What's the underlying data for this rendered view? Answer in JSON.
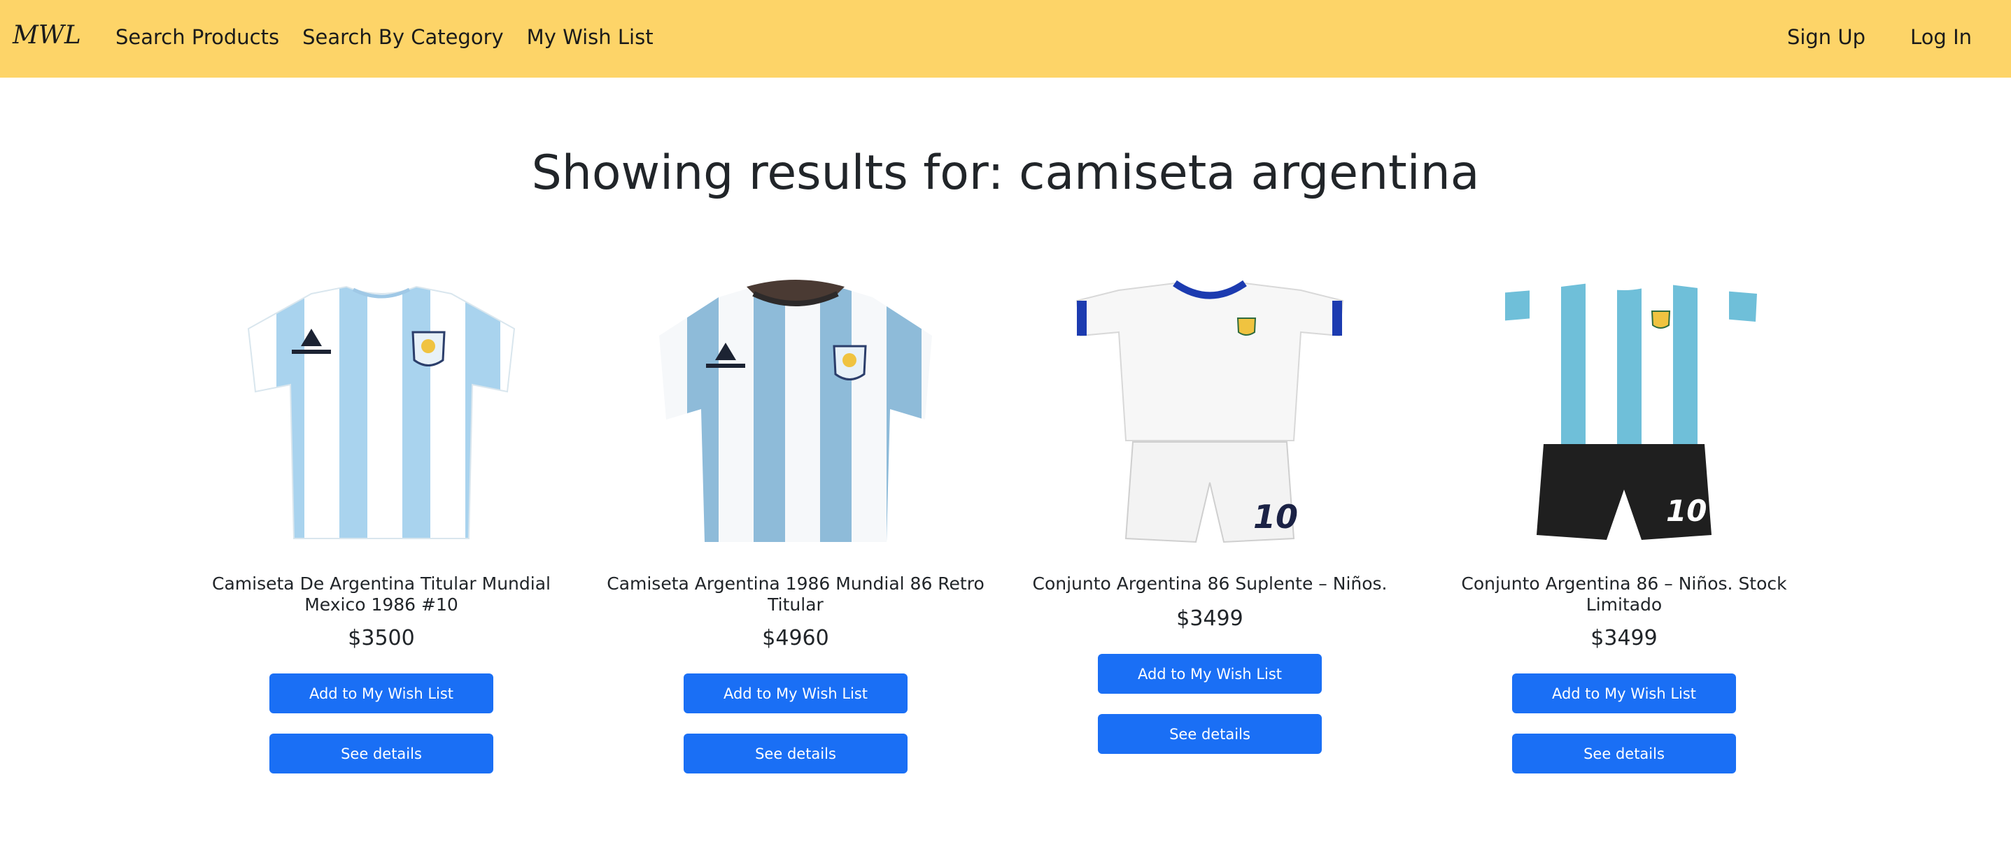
{
  "nav": {
    "brand": "MWL",
    "links": [
      "Search Products",
      "Search By Category",
      "My Wish List"
    ],
    "right": [
      "Sign Up",
      "Log In"
    ]
  },
  "page": {
    "title": "Showing results for: camiseta argentina"
  },
  "products": [
    {
      "name": "Camiseta De Argentina Titular Mundial Mexico 1986 #10",
      "price": "$3500",
      "add_label": "Add to My Wish List",
      "details_label": "See details"
    },
    {
      "name": "Camiseta Argentina 1986 Mundial 86 Retro Titular",
      "price": "$4960",
      "add_label": "Add to My Wish List",
      "details_label": "See details"
    },
    {
      "name": "Conjunto Argentina 86 Suplente – Niños.",
      "price": "$3499",
      "add_label": "Add to My Wish List",
      "details_label": "See details"
    },
    {
      "name": "Conjunto Argentina 86 – Niños. Stock Limitado",
      "price": "$3499",
      "add_label": "Add to My Wish List",
      "details_label": "See details"
    }
  ],
  "colors": {
    "navbar": "#fdd468",
    "button": "#1a6ff5",
    "sky_blue": "#9ccbe8",
    "shorts_black": "#1f1f1f"
  },
  "image_labels": [
    "10",
    "10"
  ]
}
